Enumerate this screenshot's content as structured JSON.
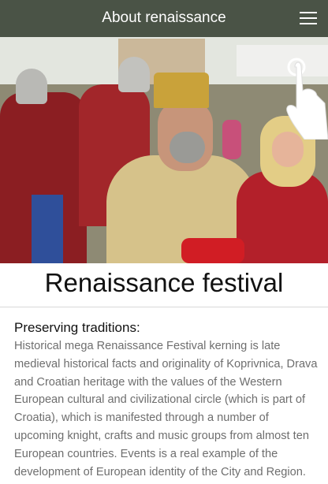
{
  "appbar": {
    "title": "About renaissance",
    "menu_icon": "hamburger-menu-icon",
    "background": "#4a5346"
  },
  "hero": {
    "image": "renaissance-festival-photo"
  },
  "page": {
    "title": "Renaissance festival",
    "section_heading": "Preserving traditions:",
    "body": "Historical mega Renaissance Festival kerning is late medieval historical facts and originality of Koprivnica, Drava and Croatian heritage with the values of the Western European cultural and civilizational circle (which is part of Croatia), which is manifested through a number of upcoming knight, crafts and music groups from almost ten European countries. Events is a real example of the development of European identity of the City and Region."
  }
}
